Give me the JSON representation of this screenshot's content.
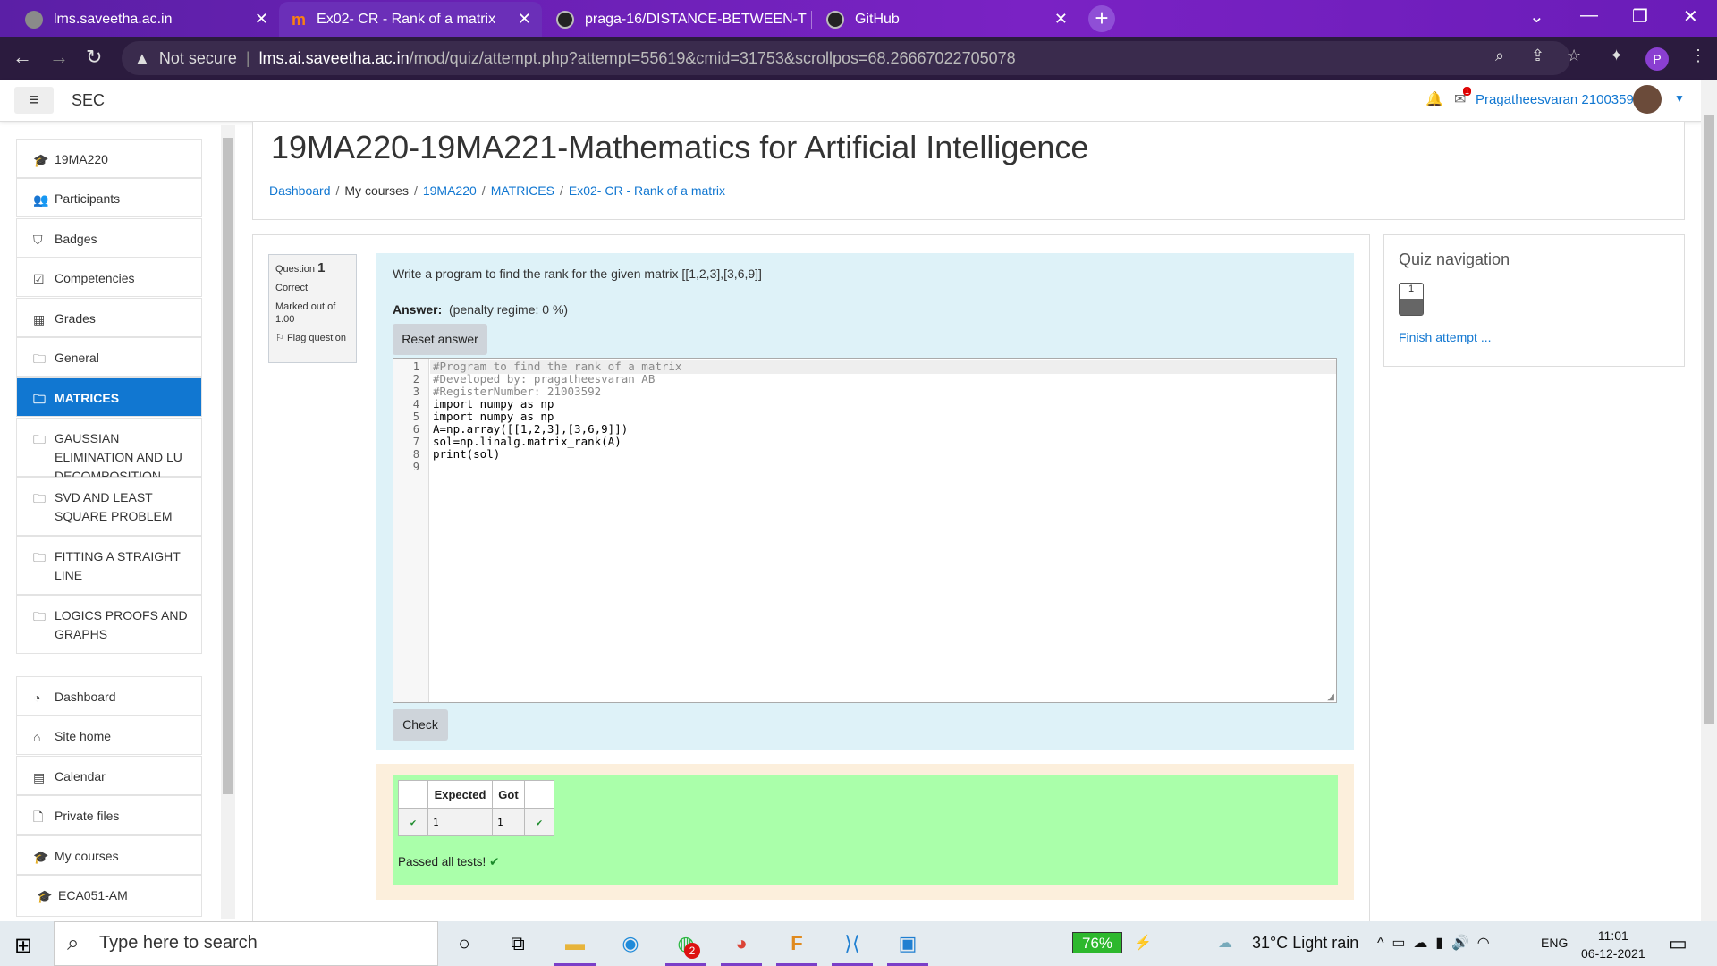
{
  "browser": {
    "tabs": [
      {
        "title": "lms.saveetha.ac.in"
      },
      {
        "title": "Ex02- CR - Rank of a matrix"
      },
      {
        "title": "praga-16/DISTANCE-BETWEEN-T"
      },
      {
        "title": "GitHub"
      }
    ],
    "new_tab_glyph": "+",
    "security_label": "Not secure",
    "url_host": "lms.ai.saveetha.ac.in",
    "url_path": "/mod/quiz/attempt.php?attempt=55619&cmid=31753&scrollpos=68.26667022705078",
    "profile_initial": "P"
  },
  "header": {
    "site_name": "SEC",
    "user_name": "Pragatheesvaran 21003592",
    "notification_badge": "1"
  },
  "sidebar": {
    "items": [
      {
        "label": "19MA220",
        "icon": "graduation-cap-icon"
      },
      {
        "label": "Participants",
        "icon": "users-icon"
      },
      {
        "label": "Badges",
        "icon": "shield-icon"
      },
      {
        "label": "Competencies",
        "icon": "check-square-icon"
      },
      {
        "label": "Grades",
        "icon": "table-icon"
      },
      {
        "label": "General",
        "icon": "folder-icon"
      },
      {
        "label": "MATRICES",
        "icon": "folder-icon"
      },
      {
        "label": "GAUSSIAN ELIMINATION AND LU DECOMPOSITION",
        "icon": "folder-icon"
      },
      {
        "label": "SVD AND LEAST SQUARE PROBLEM",
        "icon": "folder-icon"
      },
      {
        "label": "FITTING A STRAIGHT LINE",
        "icon": "folder-icon"
      },
      {
        "label": "LOGICS PROOFS AND GRAPHS",
        "icon": "folder-icon"
      },
      {
        "label": "Dashboard",
        "icon": "dashboard-icon"
      },
      {
        "label": "Site home",
        "icon": "home-icon"
      },
      {
        "label": "Calendar",
        "icon": "calendar-icon"
      },
      {
        "label": "Private files",
        "icon": "file-icon"
      },
      {
        "label": "My courses",
        "icon": "graduation-cap-icon"
      },
      {
        "label": "ECA051-AM",
        "icon": "graduation-cap-icon"
      }
    ],
    "active_item": "MATRICES"
  },
  "page": {
    "course_title": "19MA220-19MA221-Mathematics for Artificial Intelligence",
    "breadcrumb": [
      "Dashboard",
      "My courses",
      "19MA220",
      "MATRICES",
      "Ex02- CR - Rank of a matrix"
    ]
  },
  "question": {
    "label": "Question",
    "number": "1",
    "state": "Correct",
    "marked_out_of": "Marked out of 1.00",
    "flag_label": "Flag question",
    "text": "Write a program to find the rank for the given matrix [[1,2,3],[3,6,9]]",
    "answer_label": "Answer:",
    "penalty": "(penalty regime: 0 %)",
    "reset_label": "Reset answer",
    "check_label": "Check",
    "code_lines": [
      "#Program to find the rank of a matrix",
      "#Developed by: pragatheesvaran AB",
      "#RegisterNumber: 21003592",
      "import numpy as np",
      "import numpy as np",
      "A=np.array([[1,2,3],[3,6,9]])",
      "sol=np.linalg.matrix_rank(A)",
      "print(sol)",
      ""
    ],
    "line_numbers": [
      "1",
      "2",
      "3",
      "4",
      "5",
      "6",
      "7",
      "8",
      "9"
    ]
  },
  "results": {
    "headers": [
      "",
      "Expected",
      "Got",
      ""
    ],
    "rows": [
      {
        "expected": "1",
        "got": "1"
      }
    ],
    "passed_text": "Passed all tests!"
  },
  "quiz_nav": {
    "title": "Quiz navigation",
    "button_number": "1",
    "finish_label": "Finish attempt ..."
  },
  "taskbar": {
    "search_placeholder": "Type here to search",
    "battery": "76%",
    "weather": "31°C  Light rain",
    "language": "ENG",
    "time": "11:01",
    "date": "06-12-2021",
    "whatsapp_badge": "2"
  },
  "colors": {
    "accent": "#1177d1",
    "formulation_bg": "#def2f8",
    "outcome_bg": "#fcefdc",
    "pass_bg": "#aaffaa"
  }
}
